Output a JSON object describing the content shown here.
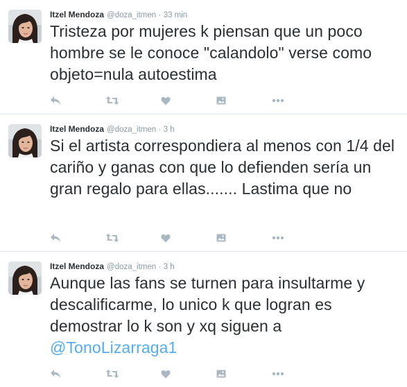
{
  "colors": {
    "text": "#292f33",
    "meta": "#8899a6",
    "icon": "#aab8c2",
    "mention": "#55acee",
    "divider": "#e1e8ed"
  },
  "tweets": [
    {
      "author": {
        "name": "Itzel Mendoza",
        "handle": "@doza_itmen"
      },
      "separator": "·",
      "time": "33 min",
      "text": "Tristeza por mujeres k piensan que un poco hombre se le conoce \"calandolo\" verse como objeto=nula autoestima",
      "mention": "",
      "icons": [
        "reply-icon",
        "retweet-icon",
        "like-icon",
        "media-icon",
        "more-icon"
      ]
    },
    {
      "author": {
        "name": "Itzel Mendoza",
        "handle": "@doza_itmen"
      },
      "separator": "·",
      "time": "3 h",
      "text": "Si el artista correspondiera al menos con 1/4 del cariño y ganas con que lo defienden sería un gran regalo para ellas....... Lastima que no",
      "mention": "",
      "icons": [
        "reply-icon",
        "retweet-icon",
        "like-icon",
        "media-icon",
        "more-icon"
      ]
    },
    {
      "author": {
        "name": "Itzel Mendoza",
        "handle": "@doza_itmen"
      },
      "separator": "·",
      "time": "3 h",
      "text": "Aunque las fans se turnen para insultarme y descalificarme, lo unico k que logran es demostrar lo k son y xq siguen a",
      "mention": "@TonoLizarraga1",
      "icons": [
        "reply-icon",
        "retweet-icon",
        "like-icon",
        "media-icon",
        "more-icon"
      ]
    }
  ]
}
